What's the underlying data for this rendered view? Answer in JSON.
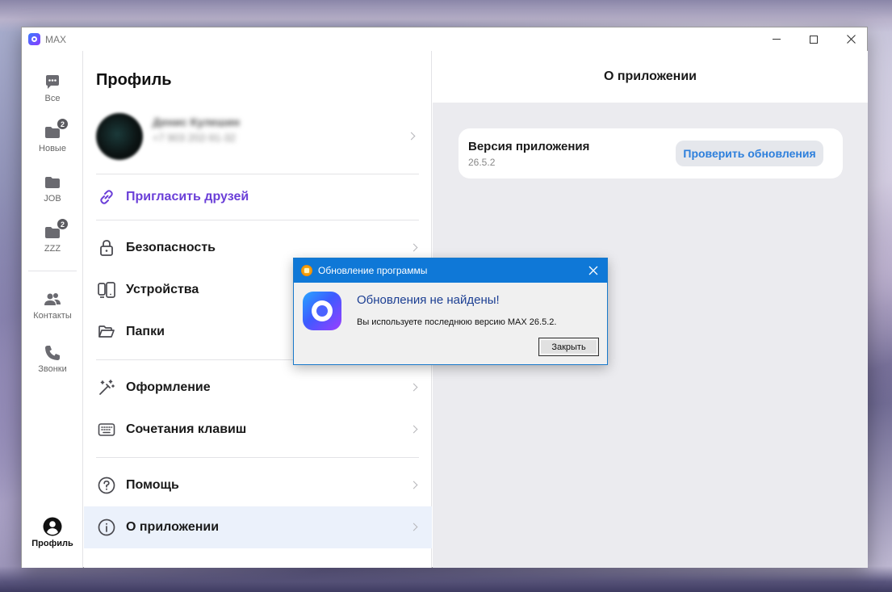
{
  "window": {
    "title": "MAX",
    "controls": [
      "minimize-icon",
      "maximize-icon",
      "close-icon"
    ]
  },
  "rail": {
    "items": [
      {
        "label": "Все",
        "icon": "chat-bubble-icon"
      },
      {
        "label": "Новые",
        "icon": "folder-icon",
        "badge": "2"
      },
      {
        "label": "JOB",
        "icon": "folder-icon"
      },
      {
        "label": "ZZZ",
        "icon": "folder-icon",
        "badge": "2"
      },
      {
        "label": "Контакты",
        "icon": "contacts-icon"
      },
      {
        "label": "Звонки",
        "icon": "phone-icon"
      },
      {
        "label": "Профиль",
        "icon": "profile-icon"
      }
    ]
  },
  "settings": {
    "title": "Профиль",
    "profile": {
      "name": "Денис Кулешин",
      "phone": "+7 903 202-91-32"
    },
    "invite_label": "Пригласить друзей",
    "items": [
      {
        "label": "Безопасность",
        "icon": "lock-icon"
      },
      {
        "label": "Устройства",
        "icon": "devices-icon"
      },
      {
        "label": "Папки",
        "icon": "folder-open-icon"
      },
      {
        "label": "Оформление",
        "icon": "magic-wand-icon"
      },
      {
        "label": "Сочетания клавиш",
        "icon": "keyboard-icon"
      },
      {
        "label": "Помощь",
        "icon": "help-icon"
      },
      {
        "label": "О приложении",
        "icon": "info-icon",
        "active": true
      }
    ]
  },
  "about": {
    "title": "О приложении",
    "version_label": "Версия приложения",
    "version_value": "26.5.2",
    "check_button": "Проверить обновления"
  },
  "dialog": {
    "title": "Обновление программы",
    "heading": "Обновления не найдены!",
    "text": "Вы используете последнюю версию MAX 26.5.2.",
    "button": "Закрыть"
  },
  "colors": {
    "accent_purple": "#6b3fd8",
    "accent_blue": "#2d7fdc",
    "dialog_titlebar": "#0f78d7",
    "active_row": "#ebf1fb"
  }
}
